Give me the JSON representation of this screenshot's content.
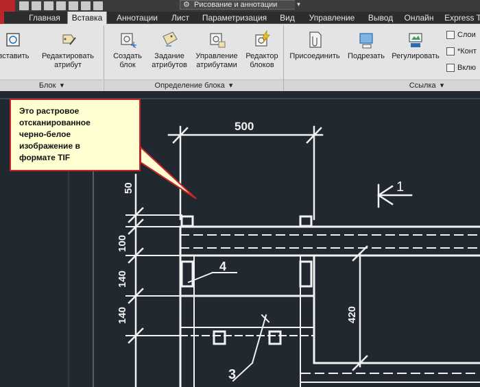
{
  "quick_access": {
    "workspace": "Рисование и аннотации",
    "workspace_icon": "gear-icon"
  },
  "tabs": [
    {
      "label": "Главная",
      "active": false
    },
    {
      "label": "Вставка",
      "active": true
    },
    {
      "label": "Аннотации",
      "active": false
    },
    {
      "label": "Лист",
      "active": false
    },
    {
      "label": "Параметризация",
      "active": false
    },
    {
      "label": "Вид",
      "active": false
    },
    {
      "label": "Управление",
      "active": false
    },
    {
      "label": "Вывод",
      "active": false
    },
    {
      "label": "Онлайн",
      "active": false
    },
    {
      "label": "Express T",
      "active": false
    }
  ],
  "ribbon": {
    "block_panel": {
      "title": "Блок",
      "buttons": [
        {
          "label": "вставить",
          "icon": "insert-block-icon"
        },
        {
          "label": "Редактировать",
          "label2": "атрибут",
          "icon": "edit-attribute-icon"
        }
      ]
    },
    "block_def_panel": {
      "title": "Определение блока",
      "buttons": [
        {
          "label": "Создать",
          "label2": "блок",
          "icon": "create-block-icon"
        },
        {
          "label": "Задание",
          "label2": "атрибутов",
          "icon": "define-attributes-icon"
        },
        {
          "label": "Управление",
          "label2": "атрибутами",
          "icon": "manage-attributes-icon"
        },
        {
          "label": "Редактор",
          "label2": "блоков",
          "icon": "block-editor-icon"
        }
      ]
    },
    "reference_panel": {
      "title": "Ссылка",
      "buttons": [
        {
          "label": "Присоединить",
          "icon": "attach-icon"
        },
        {
          "label": "Подрезать",
          "icon": "clip-icon"
        },
        {
          "label": "Регулировать",
          "icon": "adjust-icon"
        }
      ],
      "small_items": [
        {
          "label": "Слои",
          "icon": "layers-icon"
        },
        {
          "label": "*Конт",
          "icon": "frame-icon"
        },
        {
          "label": "Вклю",
          "icon": "snap-icon"
        }
      ]
    }
  },
  "callout": {
    "line1": "Это растровое",
    "line2": "отсканированное",
    "line3": "черно-белое",
    "line4": "изображение в",
    "line5": "формате TIF"
  },
  "drawing": {
    "dim_top": "500",
    "dim_50": "50",
    "dim_100": "100",
    "dim_140a": "140",
    "dim_140b": "140",
    "dim_420": "420",
    "label_1": "1",
    "label_3": "3",
    "label_4": "4",
    "colors": {
      "background": "#212830",
      "lines": "#f2f2f2",
      "callout_border": "#c8242a",
      "callout_fill": "#ffffd2"
    }
  }
}
